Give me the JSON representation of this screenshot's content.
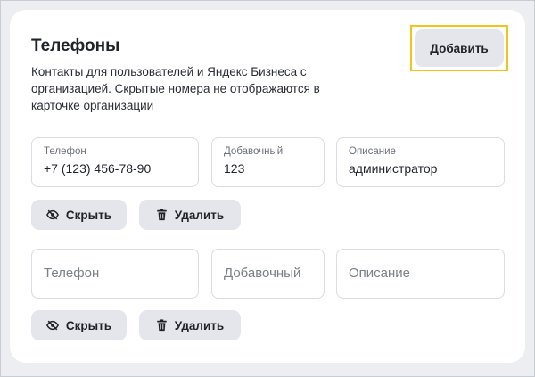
{
  "section": {
    "title": "Телефоны",
    "description": "Контакты для пользователей и Яндекс Бизнеса с организацией. Скрытые номера не отображаются в карточке организации",
    "add_label": "Добавить"
  },
  "phones": [
    {
      "phone_label": "Телефон",
      "phone_value": "+7 (123) 456-78-90",
      "ext_label": "Добавочный",
      "ext_value": "123",
      "desc_label": "Описание",
      "desc_value": "администратор",
      "hide_label": "Скрыть",
      "delete_label": "Удалить"
    },
    {
      "phone_placeholder": "Телефон",
      "ext_placeholder": "Добавочный",
      "desc_placeholder": "Описание",
      "hide_label": "Скрыть",
      "delete_label": "Удалить"
    }
  ],
  "icons": {
    "hide": "eye-off-icon",
    "delete": "trash-icon"
  },
  "colors": {
    "highlight": "#f0c419",
    "button_bg": "#e4e6ec",
    "card_bg": "#ffffff",
    "page_bg": "#eceef2"
  }
}
